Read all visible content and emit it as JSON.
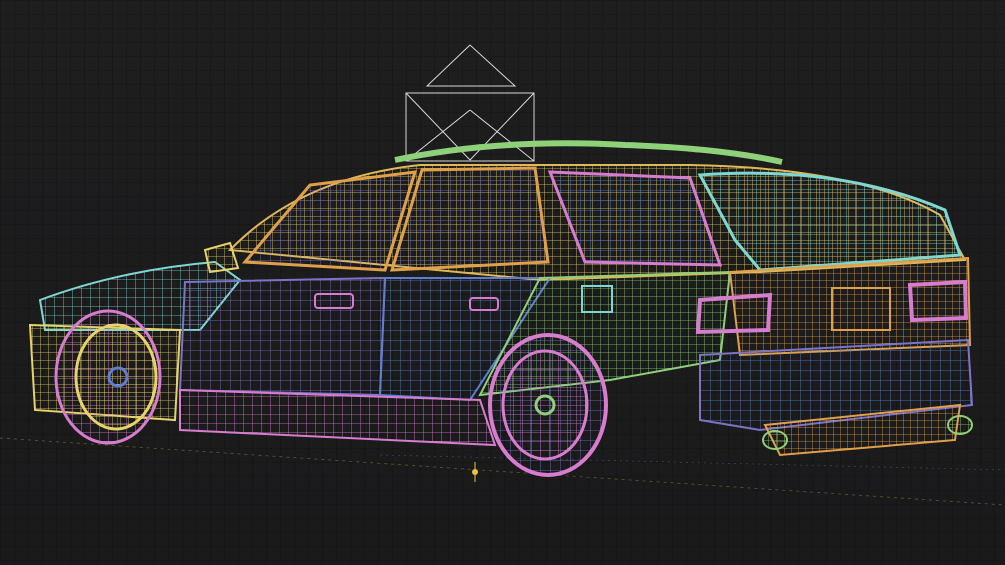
{
  "viewport": {
    "background": "#1c1c1d",
    "grid_color": "#2a2a2b",
    "shading_mode": "wireframe"
  },
  "model": {
    "kind": "station-wagon car",
    "palette": {
      "yellow": "#e6d36a",
      "green": "#8fd07a",
      "cyan": "#7fd7d2",
      "purple": "#7d73c8",
      "pink": "#d77ccf",
      "orange": "#e0a04a",
      "blue": "#5e7fd0"
    }
  },
  "camera_gizmo": {
    "icon": "camera-frustum-icon",
    "color": "#d8d8d8"
  },
  "origin_marker": {
    "icon": "origin-marker-icon",
    "color": "#f0c040"
  }
}
